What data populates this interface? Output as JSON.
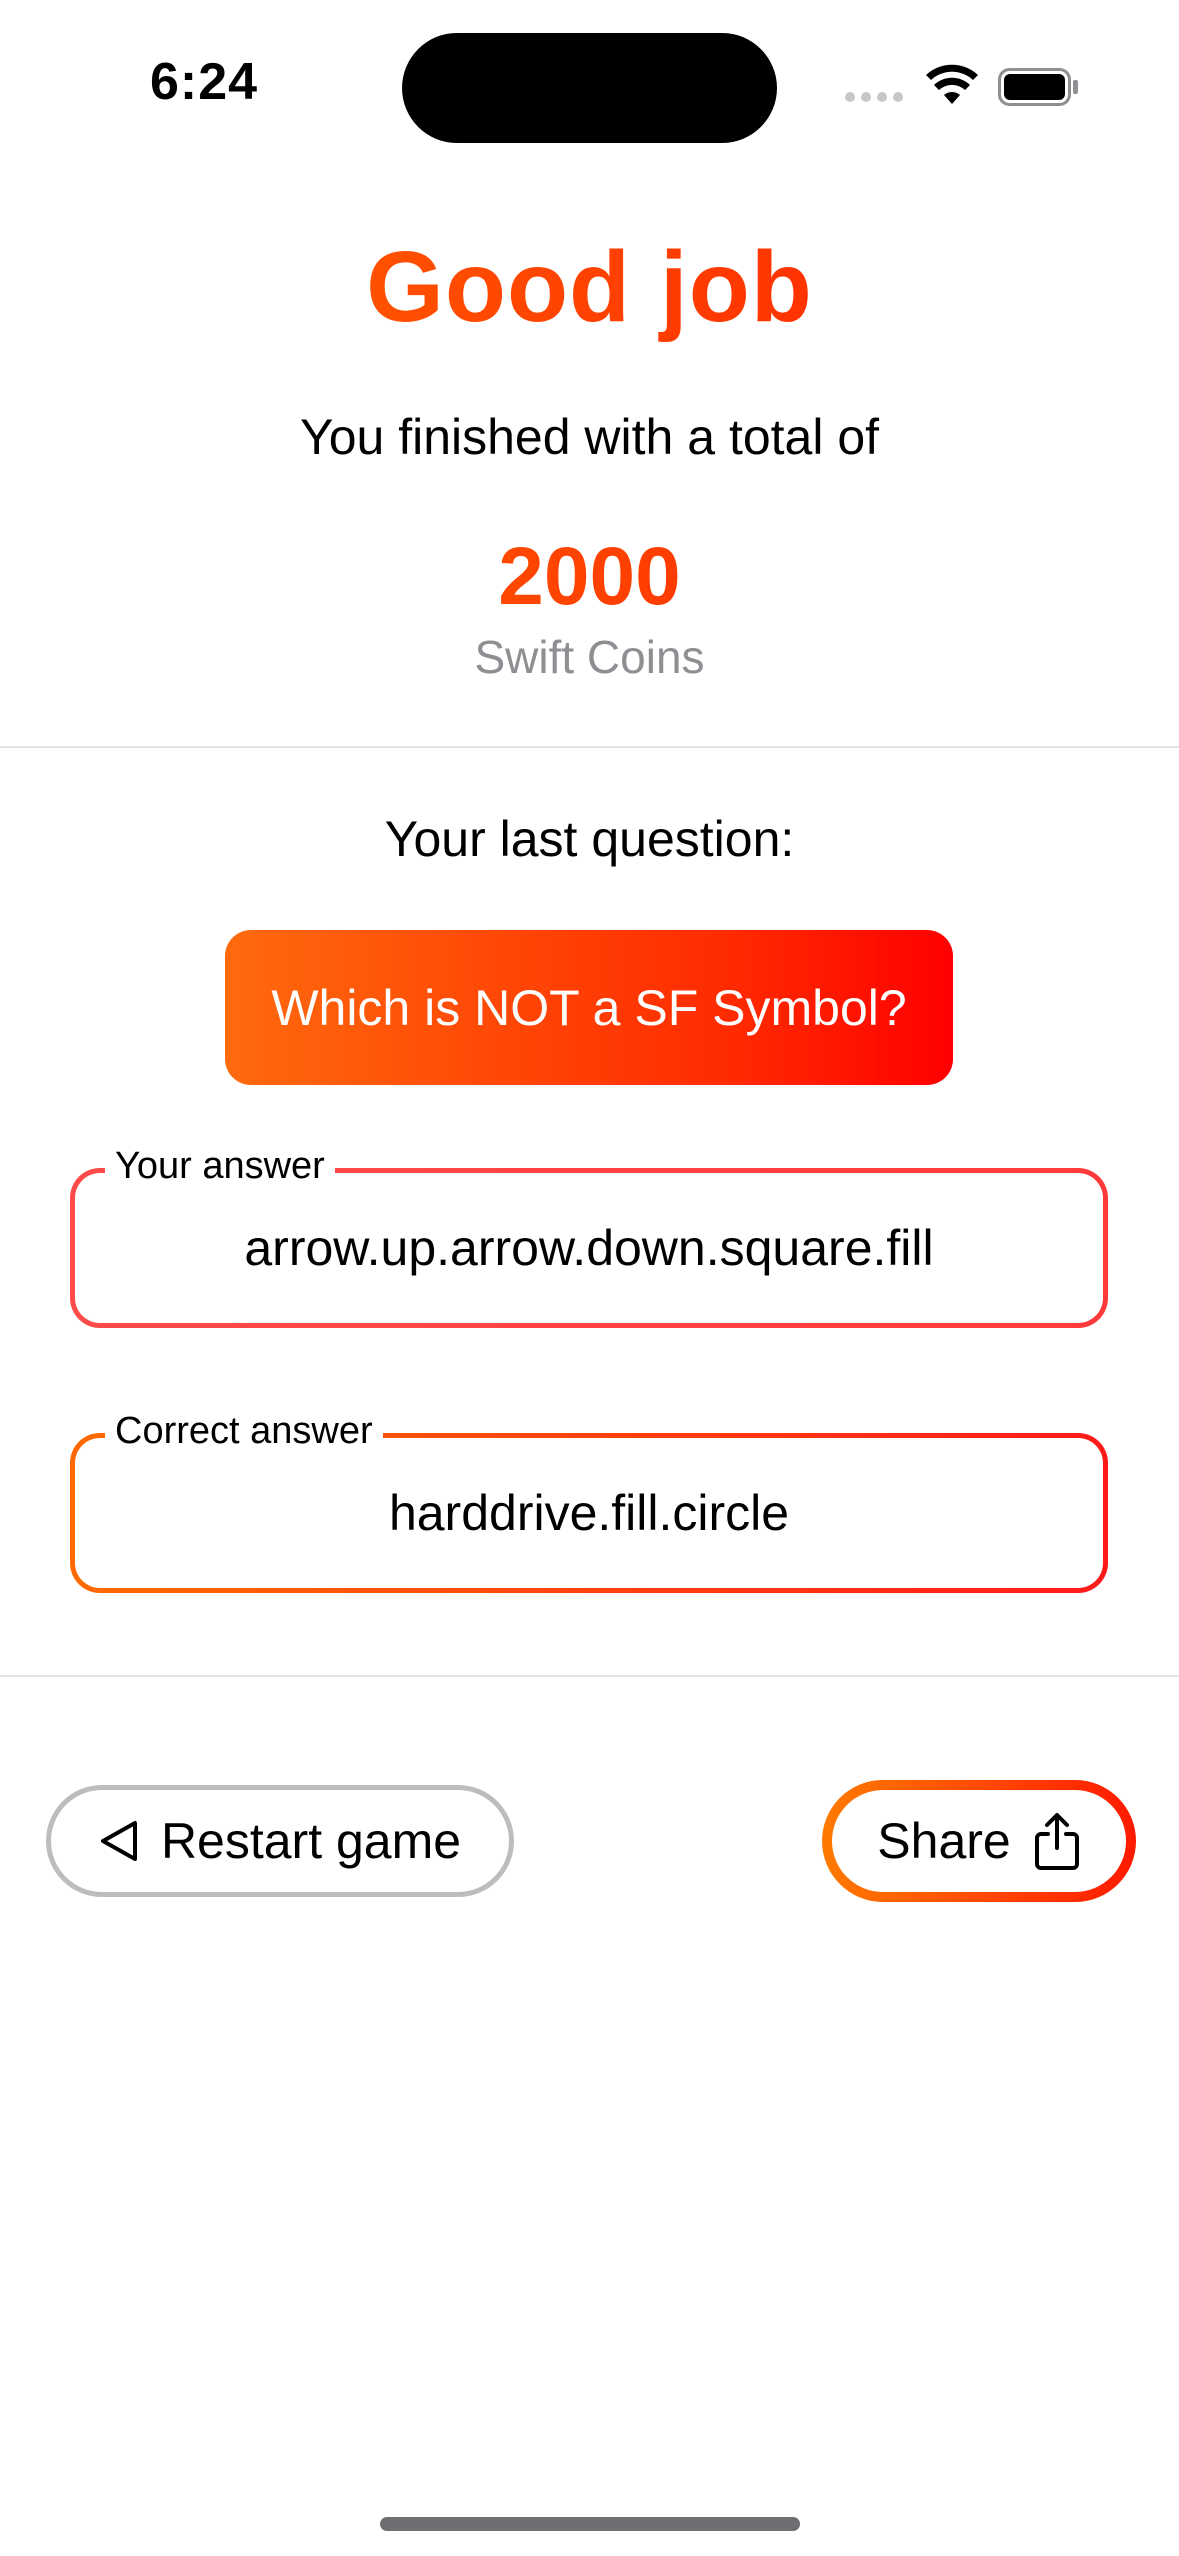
{
  "status_bar": {
    "time": "6:24"
  },
  "header": {
    "title": "Good job",
    "subtitle": "You finished with a total of",
    "score": "2000",
    "score_unit": "Swift Coins"
  },
  "last_question": {
    "label": "Your last question:",
    "question": "Which is NOT a SF Symbol?"
  },
  "answers": {
    "your_answer_label": "Your answer",
    "your_answer_value": "arrow.up.arrow.down.square.fill",
    "correct_answer_label": "Correct answer",
    "correct_answer_value": "harddrive.fill.circle"
  },
  "actions": {
    "restart_label": "Restart game",
    "share_label": "Share"
  },
  "icons": {
    "restart": "back-triangle-icon",
    "share": "share-icon"
  },
  "colors": {
    "accent_start": "#ff6a00",
    "accent_end": "#ff1a00",
    "muted_text": "#8e8e93"
  }
}
